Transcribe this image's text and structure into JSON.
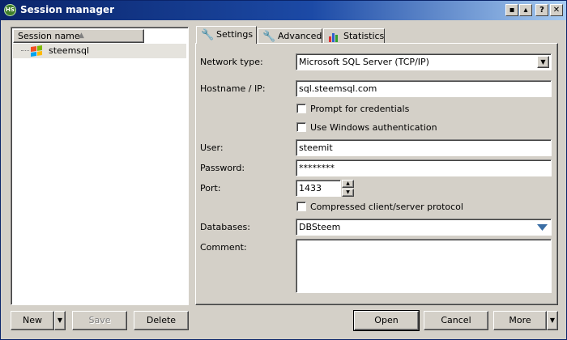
{
  "window": {
    "title": "Session manager",
    "icon_text": "HS",
    "buttons": {
      "restore": "▪",
      "resize": "▴",
      "help": "?",
      "close": "✕"
    }
  },
  "session_list": {
    "header": "Session name",
    "sort_indicator": "▲",
    "items": [
      {
        "label": "steemsql"
      }
    ]
  },
  "tabs": [
    {
      "label": "Settings",
      "icon": "wrench-icon",
      "active": true
    },
    {
      "label": "Advanced",
      "icon": "wrench-icon",
      "active": false
    },
    {
      "label": "Statistics",
      "icon": "bar-chart-icon",
      "active": false
    }
  ],
  "settings": {
    "network_type": {
      "label": "Network type:",
      "value": "Microsoft SQL Server (TCP/IP)"
    },
    "hostname": {
      "label": "Hostname / IP:",
      "value": "sql.steemsql.com"
    },
    "prompt_credentials": {
      "label": "Prompt for credentials",
      "checked": false
    },
    "windows_auth": {
      "label": "Use Windows authentication",
      "checked": false
    },
    "user": {
      "label": "User:",
      "value": "steemit"
    },
    "password": {
      "label": "Password:",
      "value": "********"
    },
    "port": {
      "label": "Port:",
      "value": "1433"
    },
    "compressed": {
      "label": "Compressed client/server protocol",
      "checked": false
    },
    "databases": {
      "label": "Databases:",
      "value": "DBSteem"
    },
    "comment": {
      "label": "Comment:",
      "value": ""
    }
  },
  "buttons": {
    "new": "New",
    "save": "Save",
    "delete": "Delete",
    "open": "Open",
    "cancel": "Cancel",
    "more": "More"
  },
  "colors": {
    "title_start": "#0a246a",
    "title_end": "#a6caf0",
    "face": "#d4d0c8",
    "combo_arrow_blue": "#3a6ea5"
  }
}
